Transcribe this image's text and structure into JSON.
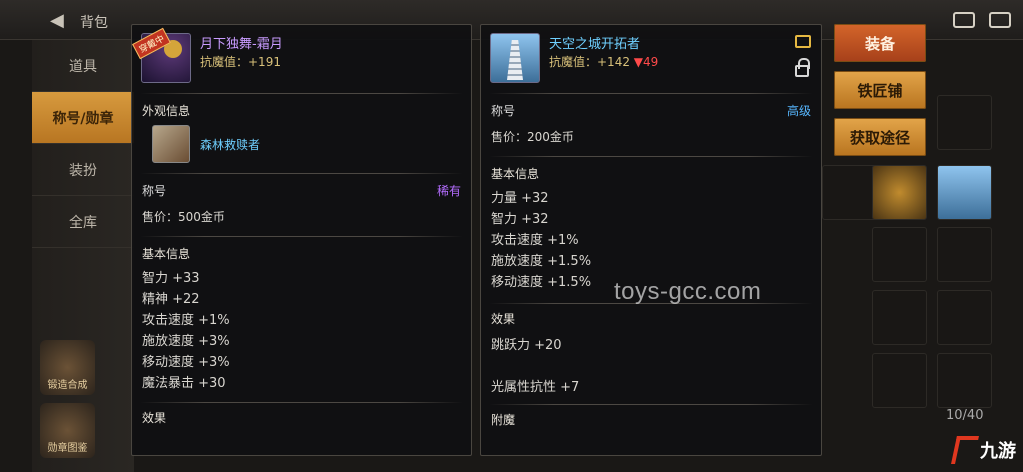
{
  "topbar": {
    "back_title": "背包"
  },
  "nav": {
    "items": [
      "道具",
      "称号/勋章",
      "装扮",
      "全库"
    ],
    "tools": [
      "锻造合成",
      "勋章图鉴"
    ]
  },
  "side_buttons": {
    "equip": "装备",
    "blacksmith": "铁匠铺",
    "obtain": "获取途径"
  },
  "inventory": {
    "count": "10/40"
  },
  "left_panel": {
    "badge": "穿戴中",
    "name": "月下独舞-霜月",
    "magic_resist": "抗魔值：+191",
    "appearance_title": "外观信息",
    "appearance_name": "森林救赎者",
    "type": "称号",
    "rarity": "稀有",
    "price": "售价：500金币",
    "basic_title": "基本信息",
    "stats": [
      "智力 +33",
      "精神 +22",
      "攻击速度 +1%",
      "施放速度 +3%",
      "移动速度 +3%",
      "魔法暴击 +30"
    ],
    "effect_title": "效果"
  },
  "right_panel": {
    "name": "天空之城开拓者",
    "magic_resist_label": "抗魔值：+142 ",
    "magic_resist_diff": "▼49",
    "type": "称号",
    "grade": "高级",
    "price": "售价：200金币",
    "basic_title": "基本信息",
    "stats": [
      "力量 +32",
      "智力 +32",
      "攻击速度 +1%",
      "施放速度 +1.5%",
      "移动速度 +1.5%"
    ],
    "effect_title": "效果",
    "effects": [
      "跳跃力 +20",
      "光属性抗性 +7"
    ],
    "enchant_title": "附魔"
  },
  "watermark": "toys-gcc.com",
  "logo": "九游",
  "colors": {
    "accent": "#d79a3e",
    "purple_name": "#c99bff",
    "blue_name": "#6fd0ff",
    "down": "#ff4a4a"
  }
}
